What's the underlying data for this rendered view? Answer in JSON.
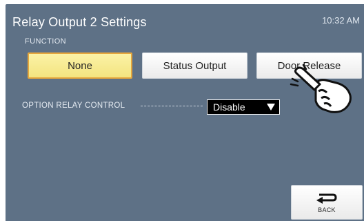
{
  "header": {
    "title": "Relay Output 2 Settings",
    "time": "10:32 AM"
  },
  "function_section": {
    "label": "FUNCTION",
    "options": [
      {
        "label": "None",
        "selected": true
      },
      {
        "label": "Status Output",
        "selected": false
      },
      {
        "label": "Door Release",
        "selected": false
      }
    ]
  },
  "option_relay": {
    "label": "OPTION RELAY CONTROL",
    "value": "Disable"
  },
  "footer": {
    "back_label": "BACK"
  },
  "icons": {
    "back": "return-arrow-icon",
    "pointer": "pointing-hand-icon"
  },
  "colors": {
    "background": "#5e7186",
    "selected_fill": "#f3e480",
    "selected_border": "#e5a63c",
    "select_fill": "#000000"
  }
}
